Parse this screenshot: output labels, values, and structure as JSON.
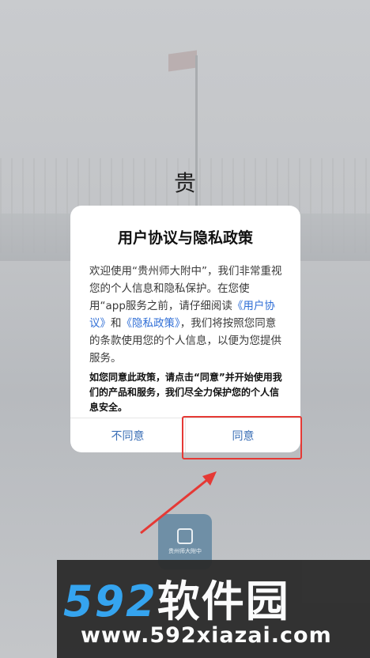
{
  "background": {
    "title": "贵",
    "app_logo_text": "贵州师大附中"
  },
  "dialog": {
    "title": "用户协议与隐私政策",
    "body_part1": "欢迎使用“贵州师大附中”，我们非常重视您的个人信息和隐私保护。在您使用“app服务之前，请仔细阅读",
    "link_user_agreement": "《用户协议》",
    "body_and": "和",
    "link_privacy_policy": "《隐私政策》",
    "body_part2": "，我们将按照您同意的条款使用您的个人信息，以便为您提供服务。",
    "note": "如您同意此政策，请点击“同意”并开始使用我们的产品和服务，我们尽全力保护您的个人信息安全。",
    "reject_label": "不同意",
    "agree_label": "同意"
  },
  "watermark": {
    "digits": "592",
    "brand": "软件园",
    "url": "www.592xiazai.com"
  },
  "colors": {
    "link": "#2f6ed6",
    "button_text": "#3b6fb6",
    "highlight": "#e53935",
    "watermark_blue": "#2ea3f2"
  }
}
